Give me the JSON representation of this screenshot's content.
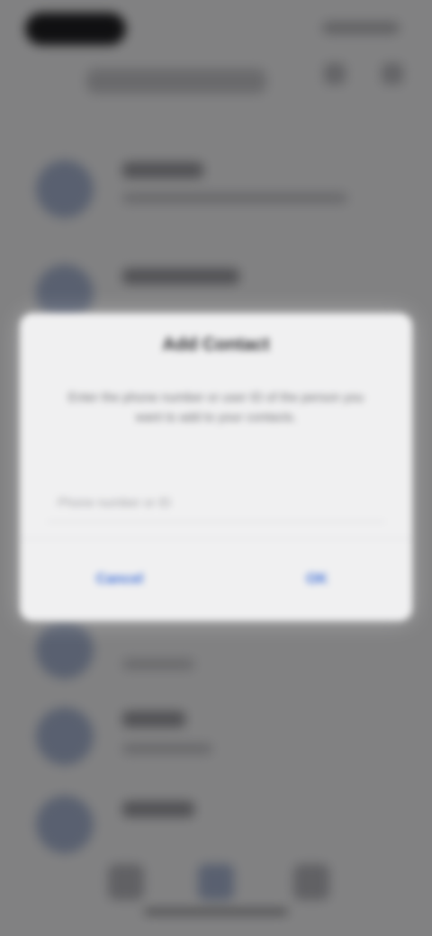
{
  "dialog": {
    "title": "Add Contact",
    "message": "Enter the phone number or user ID of the person you want to add to your contacts.",
    "input_placeholder": "Phone number or ID",
    "cancel_label": "Cancel",
    "ok_label": "OK"
  },
  "colors": {
    "accent": "#3f6fd6",
    "scrim": "#00000078",
    "dialog_bg": "#f0f0f1"
  },
  "icons": {
    "header_left": "search-icon",
    "header_right": "add-icon",
    "nav": [
      "chat-icon",
      "contacts-icon",
      "profile-icon"
    ]
  }
}
